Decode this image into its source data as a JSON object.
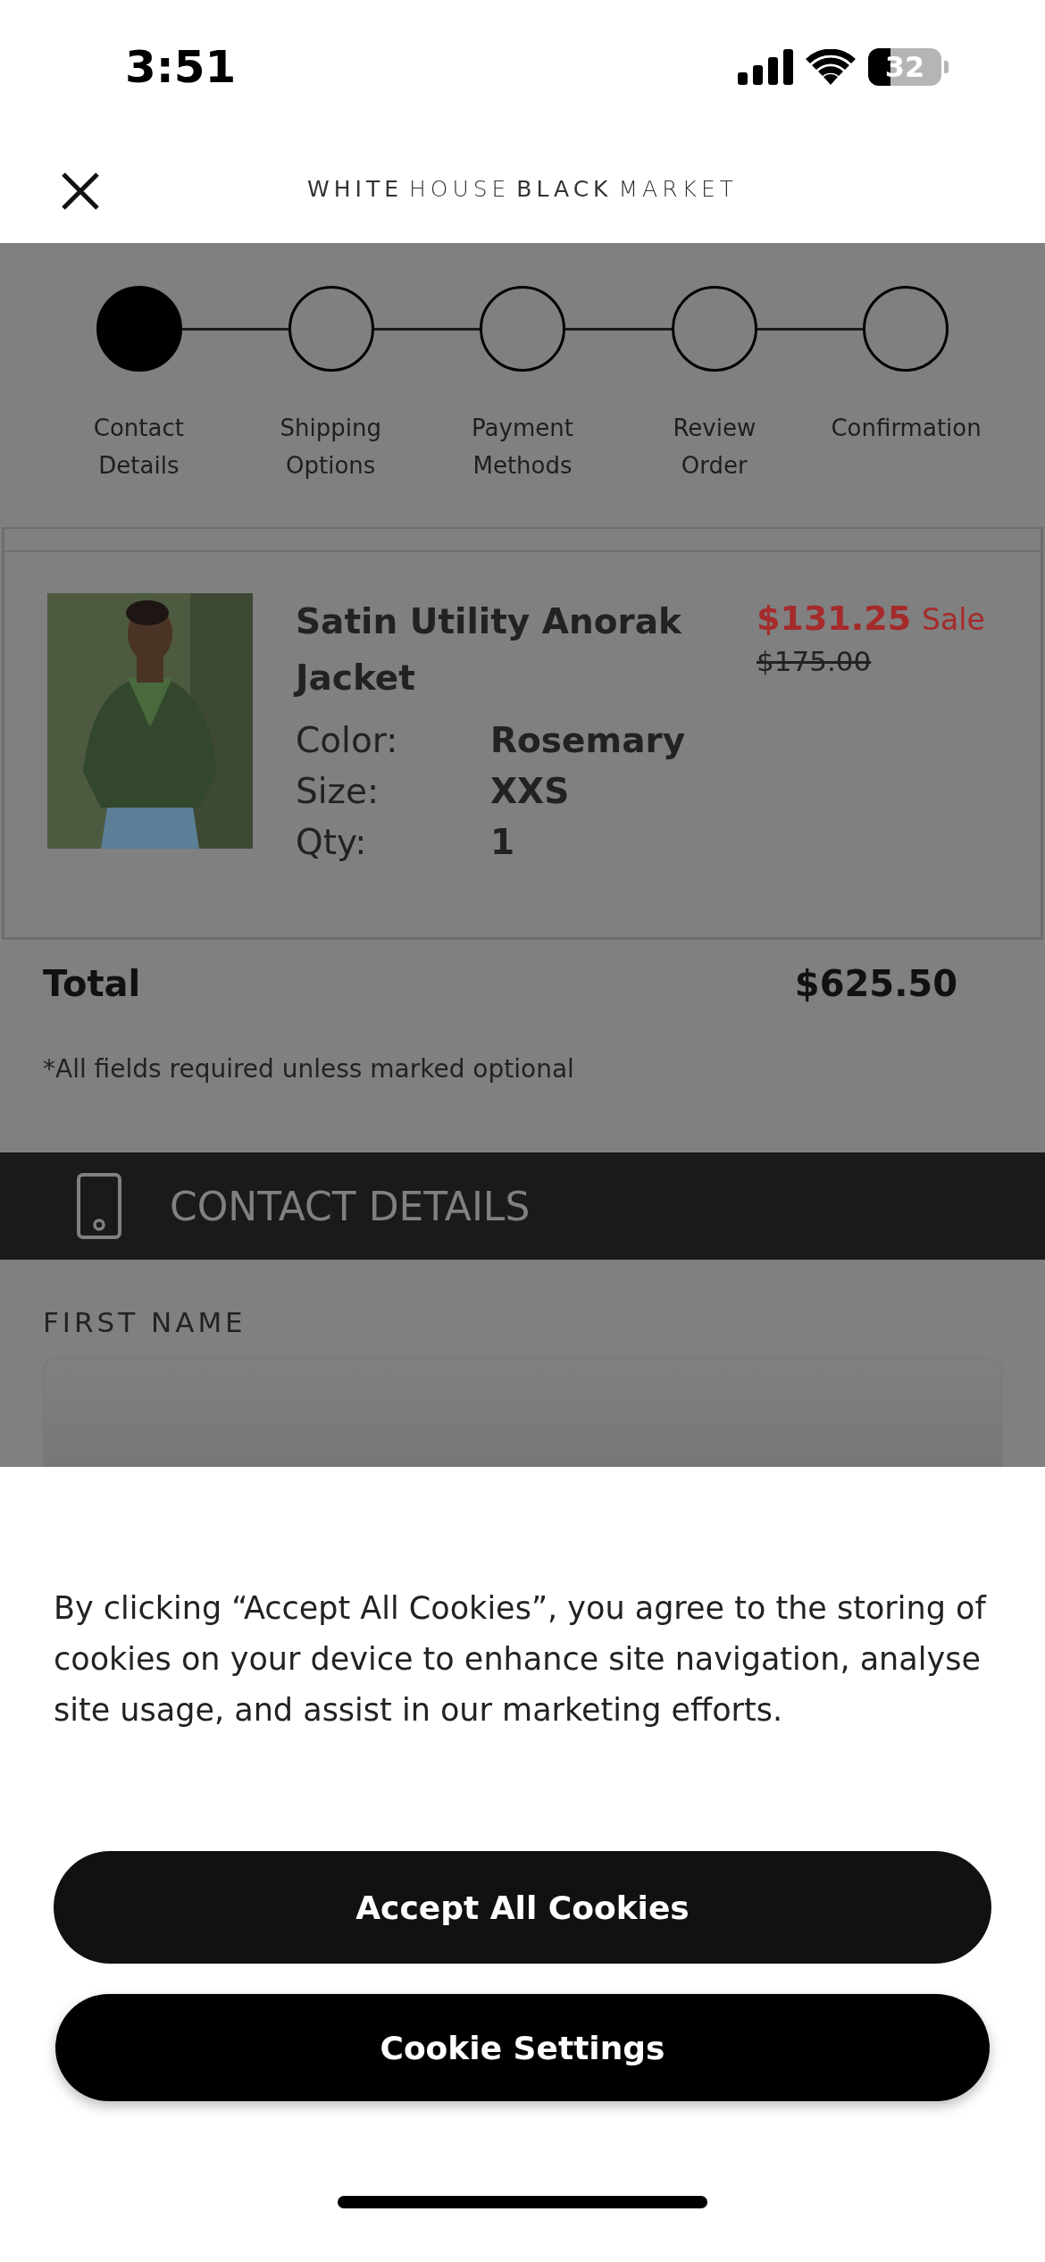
{
  "status_bar": {
    "time": "3:51",
    "battery": "32"
  },
  "header": {
    "logo": "**WHITE** HOUSE **BLACK** MARKET"
  },
  "stepper": [
    {
      "label": "Contact\nDetails",
      "selected": true
    },
    {
      "label": "Shipping\nOptions",
      "selected": false
    },
    {
      "label": "Payment\nMethods",
      "selected": false
    },
    {
      "label": "Review\nOrder",
      "selected": false
    },
    {
      "label": "Confirmation",
      "selected": false
    }
  ],
  "product": {
    "title": "Satin Utility Anorak Jacket",
    "price": "$131.25",
    "price_tag": "Sale",
    "original_price": "$175.00",
    "attributes": [
      {
        "label": "Color:",
        "value": "Rosemary"
      },
      {
        "label": "Size:",
        "value": "XXS"
      },
      {
        "label": "Qty:",
        "value": "1"
      }
    ]
  },
  "total": {
    "label": "Total",
    "value": "$625.50"
  },
  "note": "*All fields required unless marked optional",
  "section": {
    "title": "CONTACT DETAILS"
  },
  "field": {
    "label": "FIRST NAME"
  },
  "cookie_banner": {
    "text": "By clicking “Accept All Cookies”, you agree to the storing of cookies on your device to enhance site navigation, analyse site usage, and assist in our marketing efforts.",
    "buttons": [
      {
        "label": "Accept All Cookies"
      },
      {
        "label": "Cookie Settings"
      }
    ]
  }
}
